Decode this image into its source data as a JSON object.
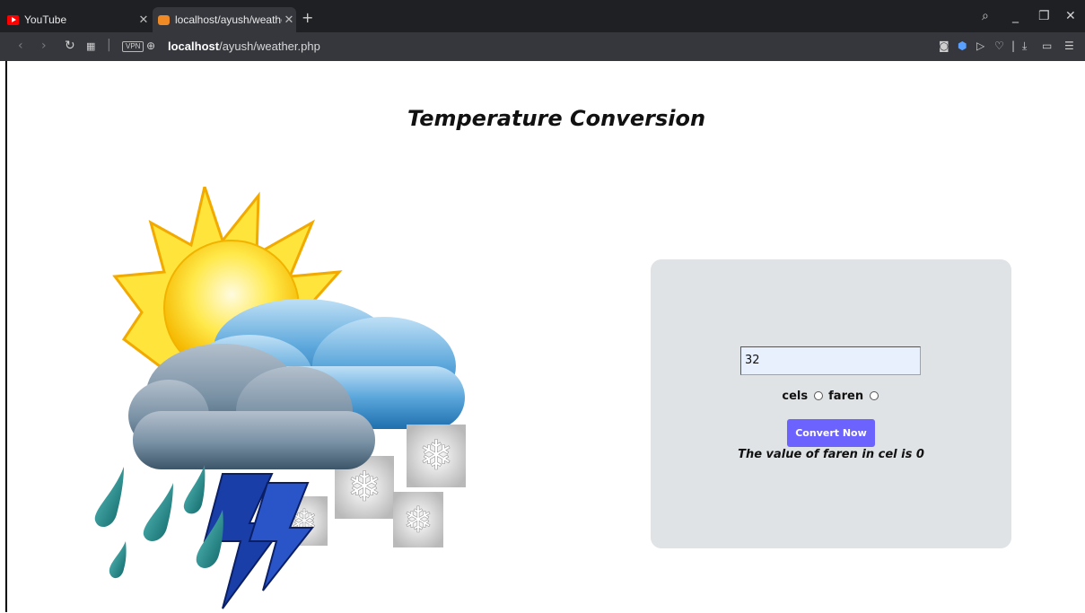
{
  "browser": {
    "tabs": [
      {
        "label": "YouTube",
        "favicon": "youtube-icon"
      },
      {
        "label": "localhost/ayush/weather.pl",
        "favicon": "xampp-icon",
        "active": true
      }
    ],
    "address": {
      "host": "localhost",
      "path": "/ayush/weather.php"
    },
    "vpn_label": "VPN"
  },
  "page": {
    "heading": "Temperature Conversion",
    "form": {
      "input_value": "32",
      "radio_cels_label": "cels",
      "radio_faren_label": "faren",
      "button_label": "Convert Now",
      "result_text": "The value of faren in cel is 0"
    },
    "illustration": "weather-illustration-sun-clouds-rain-snow-lightning"
  },
  "colors": {
    "button": "#6c63ff",
    "card": "#dfe3e6",
    "input": "#e8f0fe"
  }
}
